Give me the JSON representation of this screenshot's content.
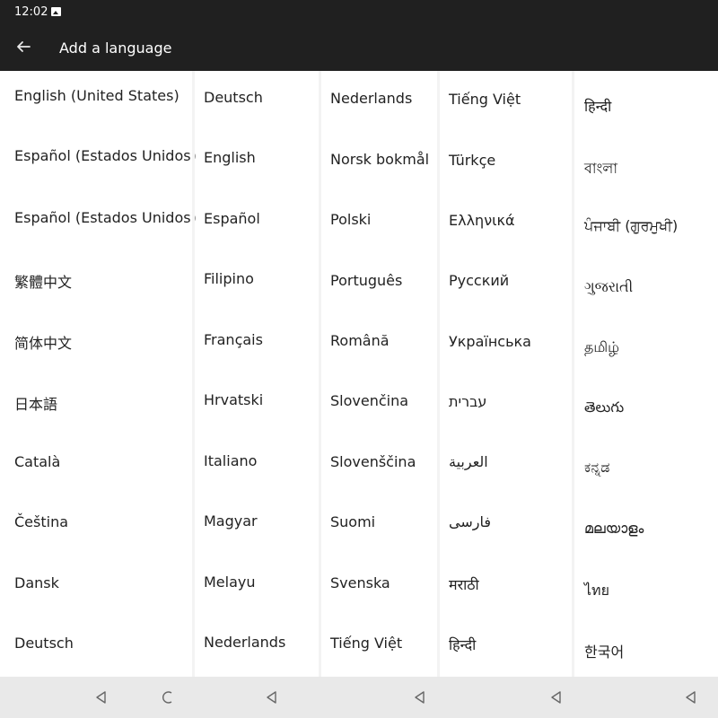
{
  "status_bar": {
    "time": "12:02",
    "notification_icon": "image-icon"
  },
  "app_bar": {
    "back_icon": "arrow-left-icon",
    "title": "Add a language"
  },
  "language_columns": [
    [
      "English (United States)",
      "Español (Estados Unidos)",
      "Español (Estados Unidos)",
      "繁體中文",
      "简体中文",
      "日本語",
      "Català",
      "Čeština",
      "Dansk",
      "Deutsch"
    ],
    [
      "Deutsch",
      "English",
      "Español",
      "Filipino",
      "Français",
      "Hrvatski",
      "Italiano",
      "Magyar",
      "Melayu",
      "Nederlands"
    ],
    [
      "Nederlands",
      "Norsk bokmål",
      "Polski",
      "Português",
      "Română",
      "Slovenčina",
      "Slovenščina",
      "Suomi",
      "Svenska",
      "Tiếng Việt"
    ],
    [
      "Tiếng Việt",
      "Türkçe",
      "Ελληνικά",
      "Русский",
      "Українська",
      "עברית",
      "العربية",
      "فارسی",
      "मराठी",
      "हिन्दी"
    ],
    [
      "हिन्दी",
      "বাংলা",
      "ਪੰਜਾਬੀ (ਗੁਰਮੁਖੀ)",
      "ગુજરાતી",
      "தமிழ்",
      "తెలుగు",
      "ಕನ್ನಡ",
      "മലയാളം",
      "ไทย",
      "한국어"
    ]
  ],
  "navigation_bar": {
    "icons": [
      "back-triangle-icon",
      "partial-circle-icon",
      "back-triangle-icon",
      "back-triangle-icon",
      "back-triangle-icon",
      "back-triangle-icon"
    ]
  },
  "colors": {
    "app_bar": "#202020",
    "content_background": "#ffffff",
    "nav_bar": "#e9e9e9",
    "text": "#222222"
  }
}
